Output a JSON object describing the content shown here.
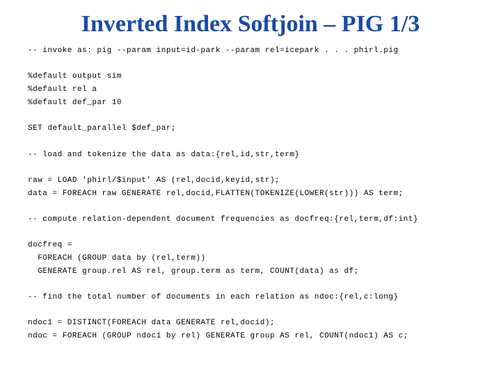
{
  "title": "Inverted Index Softjoin – PIG 1/3",
  "code": {
    "l01": "-- invoke as: pig --param input=id-park --param rel=icepark . . . phirl.pig",
    "l02": "",
    "l03": "%default output sim",
    "l04": "%default rel a",
    "l05": "%default def_par 10",
    "l06": "",
    "l07": "SET default_parallel $def_par;",
    "l08": "",
    "l09": "-- load and tokenize the data as data:{rel,id,str,term}",
    "l10": "",
    "l11": "raw = LOAD 'phirl/$input' AS (rel,docid,keyid,str);",
    "l12": "data = FOREACH raw GENERATE rel,docid,FLATTEN(TOKENIZE(LOWER(str))) AS term;",
    "l13": "",
    "l14": "-- compute relation-dependent document frequencies as docfreq:{rel,term,df:int}",
    "l15": "",
    "l16": "docfreq =",
    "l17": "  FOREACH (GROUP data by (rel,term))",
    "l18": "  GENERATE group.rel AS rel, group.term as term, COUNT(data) as df;",
    "l19": "",
    "l20": "-- find the total number of documents in each relation as ndoc:{rel,c:long}",
    "l21": "",
    "l22": "ndoc1 = DISTINCT(FOREACH data GENERATE rel,docid);",
    "l23": "ndoc = FOREACH (GROUP ndoc1 by rel) GENERATE group AS rel, COUNT(ndoc1) AS c;"
  }
}
